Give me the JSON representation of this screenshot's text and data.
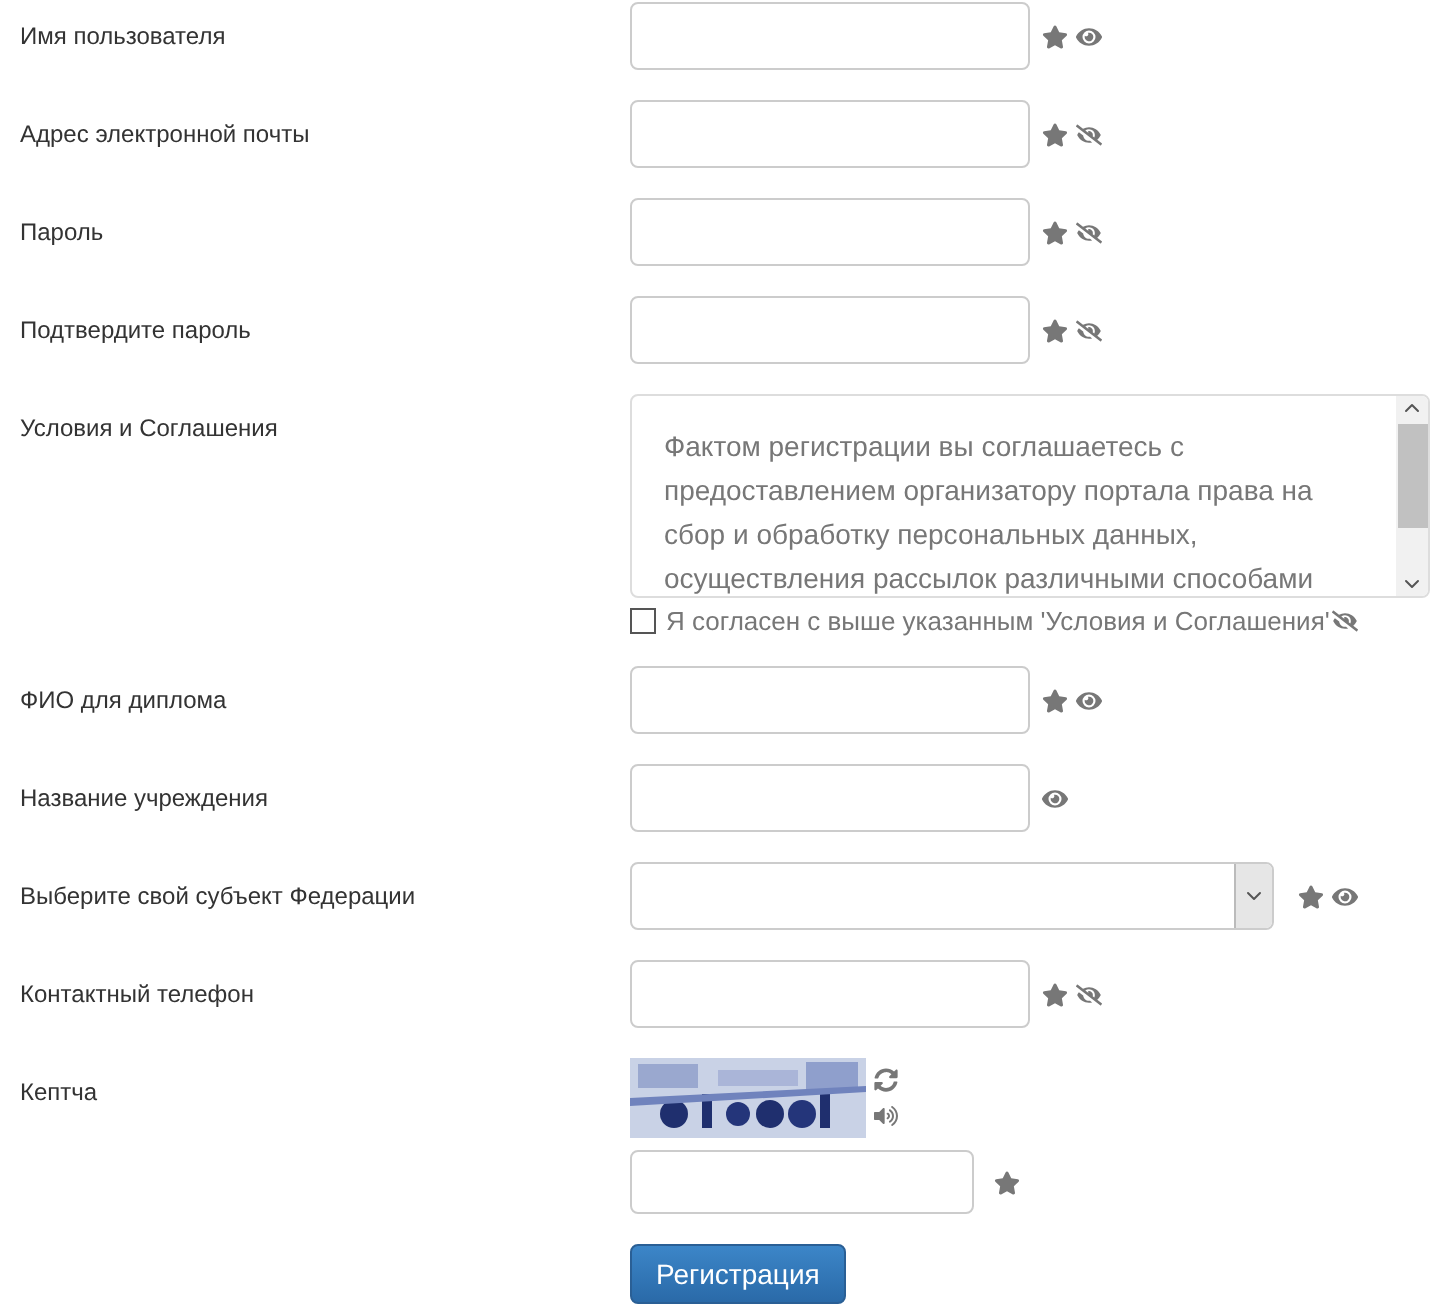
{
  "fields": [
    {
      "kind": "text",
      "label": "Имя пользователя",
      "required": true,
      "visible": true
    },
    {
      "kind": "text",
      "label": "Адрес электронной почты",
      "required": true,
      "visible": false
    },
    {
      "kind": "text",
      "label": "Пароль",
      "required": true,
      "visible": false
    },
    {
      "kind": "text",
      "label": "Подтвердите пароль",
      "required": true,
      "visible": false
    },
    {
      "kind": "terms",
      "label": "Условия и Соглашения",
      "text": "Фактом регистрации вы соглашаетесь с предоставлением организатору портала права на сбор и обработку персональных данных, осуществления рассылок различными способами",
      "agree": {
        "label": "Я согласен с выше указанным 'Условия и Соглашения'",
        "checked": false,
        "visible": false
      }
    },
    {
      "kind": "text",
      "label": "ФИО для диплома",
      "required": true,
      "visible": true
    },
    {
      "kind": "text",
      "label": "Название учреждения",
      "required": false,
      "visible": true
    },
    {
      "kind": "select",
      "label": "Выберите свой субъект Федерации",
      "required": true,
      "visible": true
    },
    {
      "kind": "text",
      "label": "Контактный телефон",
      "required": true,
      "visible": false
    },
    {
      "kind": "captcha",
      "label": "Кептча",
      "required": true
    }
  ],
  "submit": "Регистрация"
}
